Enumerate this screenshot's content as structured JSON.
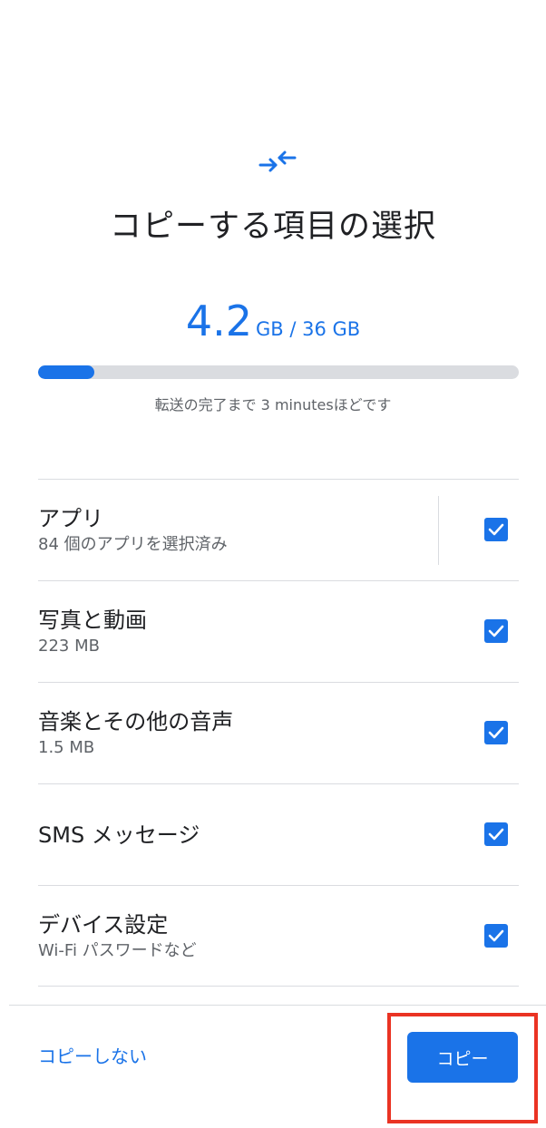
{
  "header": {
    "icon": "transfer-arrows-icon",
    "title": "コピーする項目の選択"
  },
  "storage": {
    "used": "4.2",
    "total_label": "GB / 36 GB",
    "progress_fraction": 0.117
  },
  "eta": "転送の完了まで 3 minutesほどです",
  "items": [
    {
      "label": "アプリ",
      "sub": "84 個のアプリを選択済み",
      "checked": true
    },
    {
      "label": "写真と動画",
      "sub": "223 MB",
      "checked": true
    },
    {
      "label": "音楽とその他の音声",
      "sub": "1.5 MB",
      "checked": true
    },
    {
      "label": "SMS メッセージ",
      "sub": "",
      "checked": true
    },
    {
      "label": "デバイス設定",
      "sub": "Wi-Fi パスワードなど",
      "checked": true
    }
  ],
  "footer": {
    "skip_label": "コピーしない",
    "copy_label": "コピー"
  },
  "colors": {
    "accent": "#1a73e8",
    "highlight": "#ea3323"
  }
}
